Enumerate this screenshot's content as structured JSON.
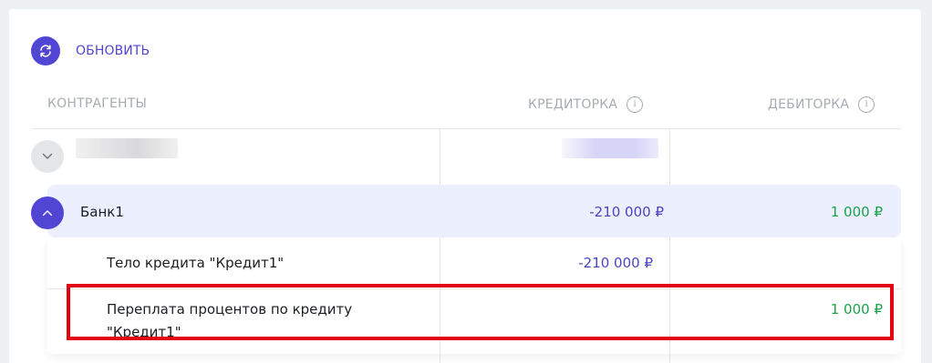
{
  "toolbar": {
    "refresh_label": "ОБНОВИТЬ",
    "refresh_icon": "refresh-icon"
  },
  "table": {
    "columns": {
      "counterparties": "КОНТРАГЕНТЫ",
      "creditor": "КРЕДИТОРКА",
      "debtor": "ДЕБИТОРКА"
    },
    "info_icon_glyph": "i",
    "rows": [
      {
        "name": "",
        "creditor": "",
        "debtor": "",
        "blurred": true
      },
      {
        "name": "Банк1",
        "creditor": "-210 000 ₽",
        "debtor": "1 000 ₽",
        "expanded": true,
        "children": [
          {
            "name": "Тело кредита \"Кредит1\"",
            "creditor": "-210 000 ₽",
            "debtor": ""
          },
          {
            "name_line1": "Переплата процентов по кредиту",
            "name_line2": "\"Кредит1\"",
            "creditor": "",
            "debtor": "1 000 ₽",
            "highlighted": true
          }
        ]
      }
    ]
  },
  "colors": {
    "accent": "#5145d4",
    "creditor": "#4a44c4",
    "debtor": "#1aa34a",
    "highlight_border": "#e3000f",
    "header_text": "#a7acb3"
  }
}
